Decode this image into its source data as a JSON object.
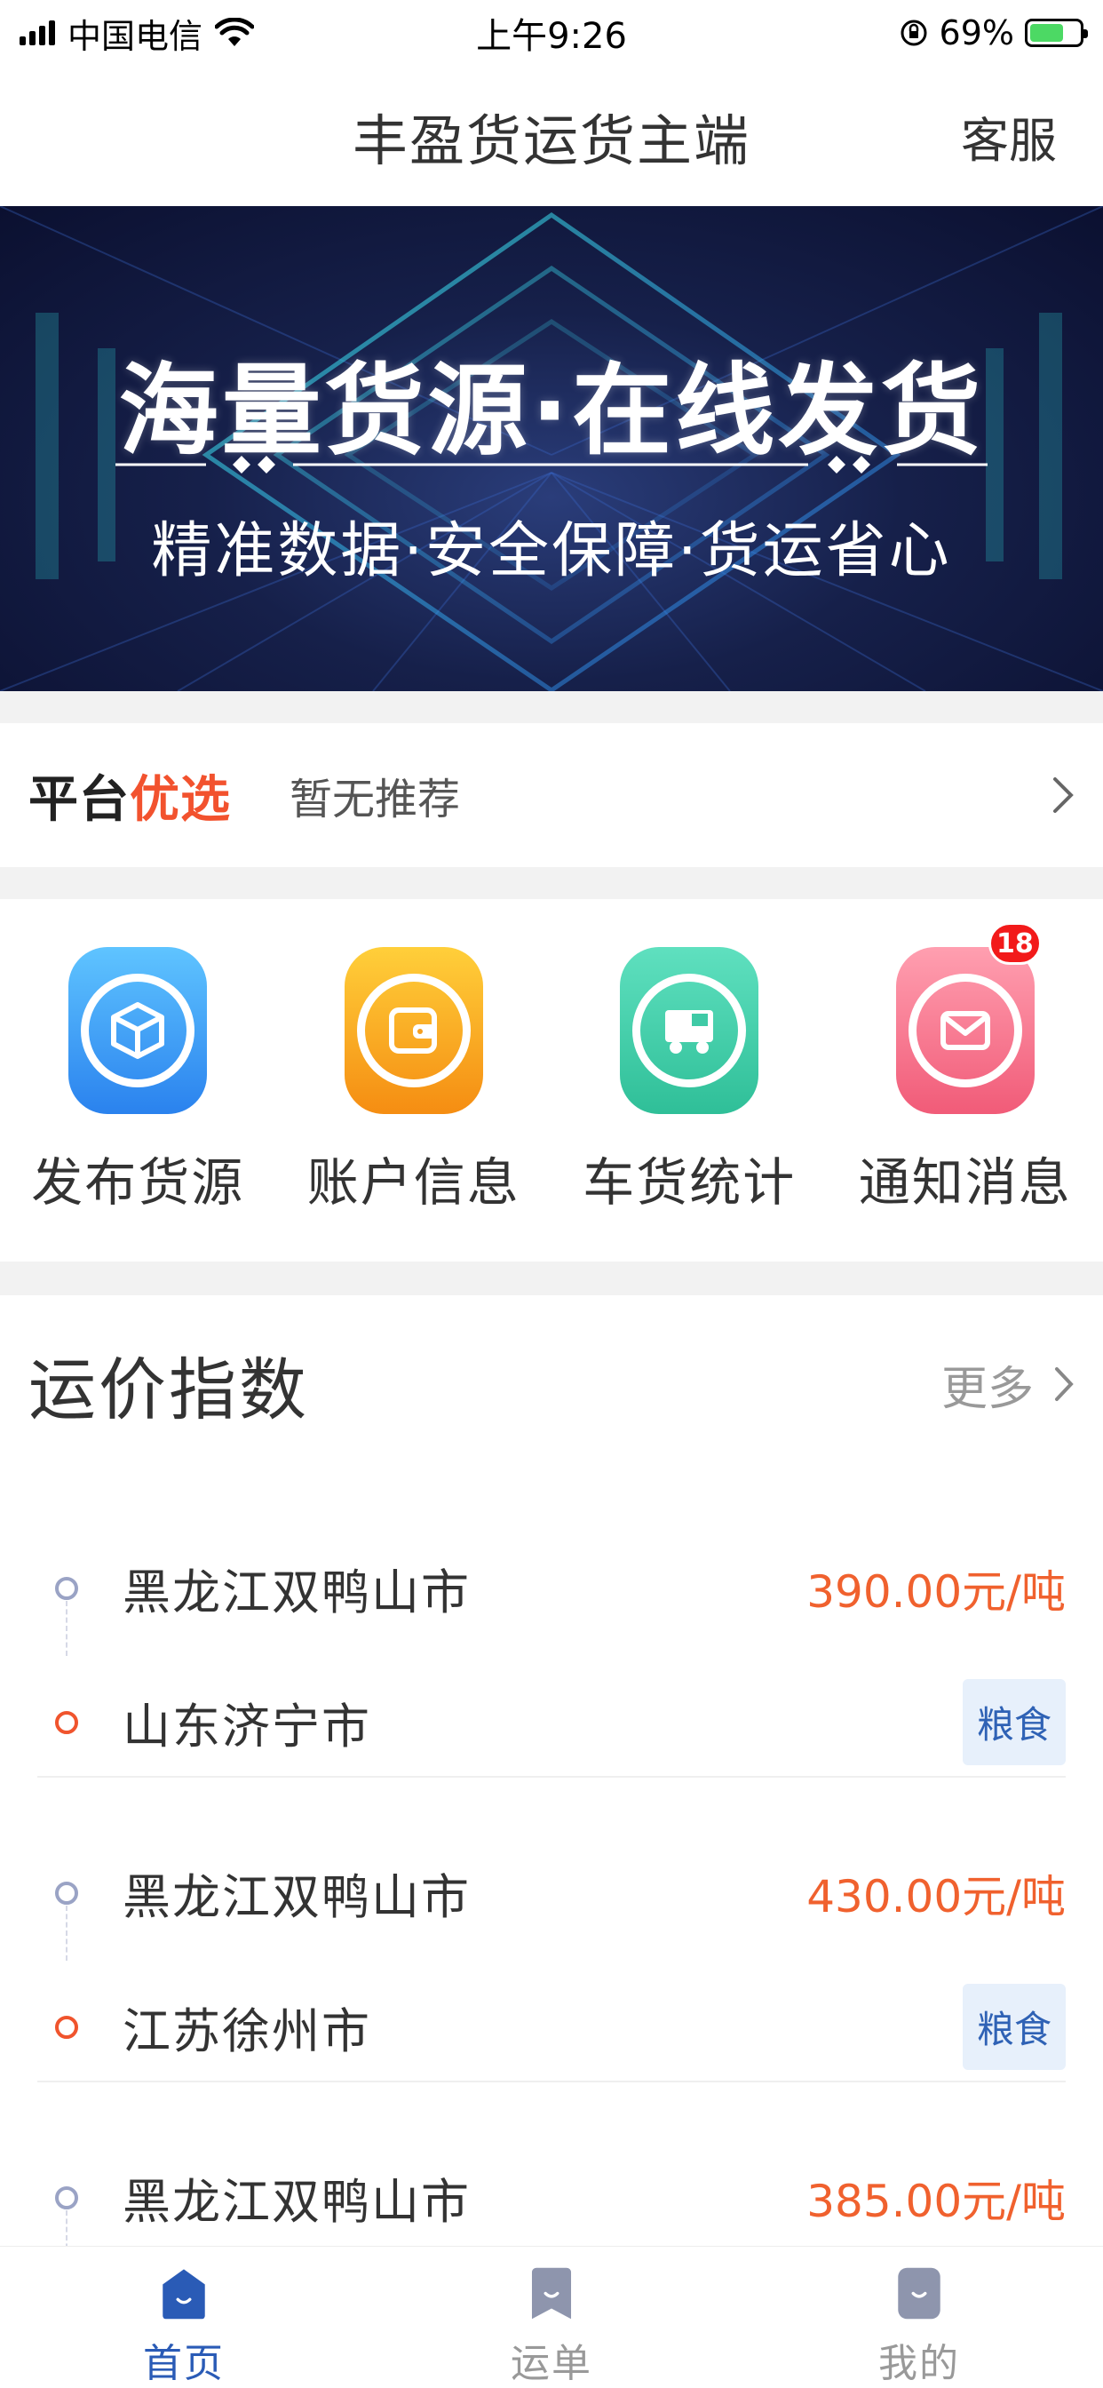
{
  "status_bar": {
    "carrier": "中国电信",
    "time": "上午9:26",
    "battery": "69%",
    "battery_level": 0.69
  },
  "nav": {
    "title": "丰盈货运货主端",
    "action_label": "客服"
  },
  "banner": {
    "headline": "海量货源·在线发货",
    "subline": "精准数据·安全保障·货运省心"
  },
  "picks": {
    "brand_prefix": "平台",
    "brand_accent": "优选",
    "text": "暂无推荐"
  },
  "actions": [
    {
      "label": "发布货源",
      "icon": "cube-icon",
      "color_from": "#5fc4ff",
      "color_to": "#2a82ee"
    },
    {
      "label": "账户信息",
      "icon": "wallet-icon",
      "color_from": "#ffcf3a",
      "color_to": "#f58d12"
    },
    {
      "label": "车货统计",
      "icon": "truck-icon",
      "color_from": "#5fe0bf",
      "color_to": "#2fbf98"
    },
    {
      "label": "通知消息",
      "icon": "envelope-icon",
      "color_from": "#ff9fb0",
      "color_to": "#f15b78",
      "badge": "18"
    }
  ],
  "freight_index": {
    "title": "运价指数",
    "more_label": "更多",
    "routes": [
      {
        "from": "黑龙江双鸭山市",
        "to": "山东济宁市",
        "price": "390.00元/吨",
        "tag": "粮食"
      },
      {
        "from": "黑龙江双鸭山市",
        "to": "江苏徐州市",
        "price": "430.00元/吨",
        "tag": "粮食"
      },
      {
        "from": "黑龙江双鸭山市",
        "to": "",
        "price": "385.00元/吨",
        "tag": ""
      }
    ]
  },
  "tabs": [
    {
      "label": "首页",
      "active": true
    },
    {
      "label": "运单",
      "active": false
    },
    {
      "label": "我的",
      "active": false
    }
  ],
  "colors": {
    "accent_blue": "#2a5bb6",
    "price_orange": "#f0612e",
    "brand_red": "#f2522e",
    "badge_red": "#f21a1a"
  }
}
